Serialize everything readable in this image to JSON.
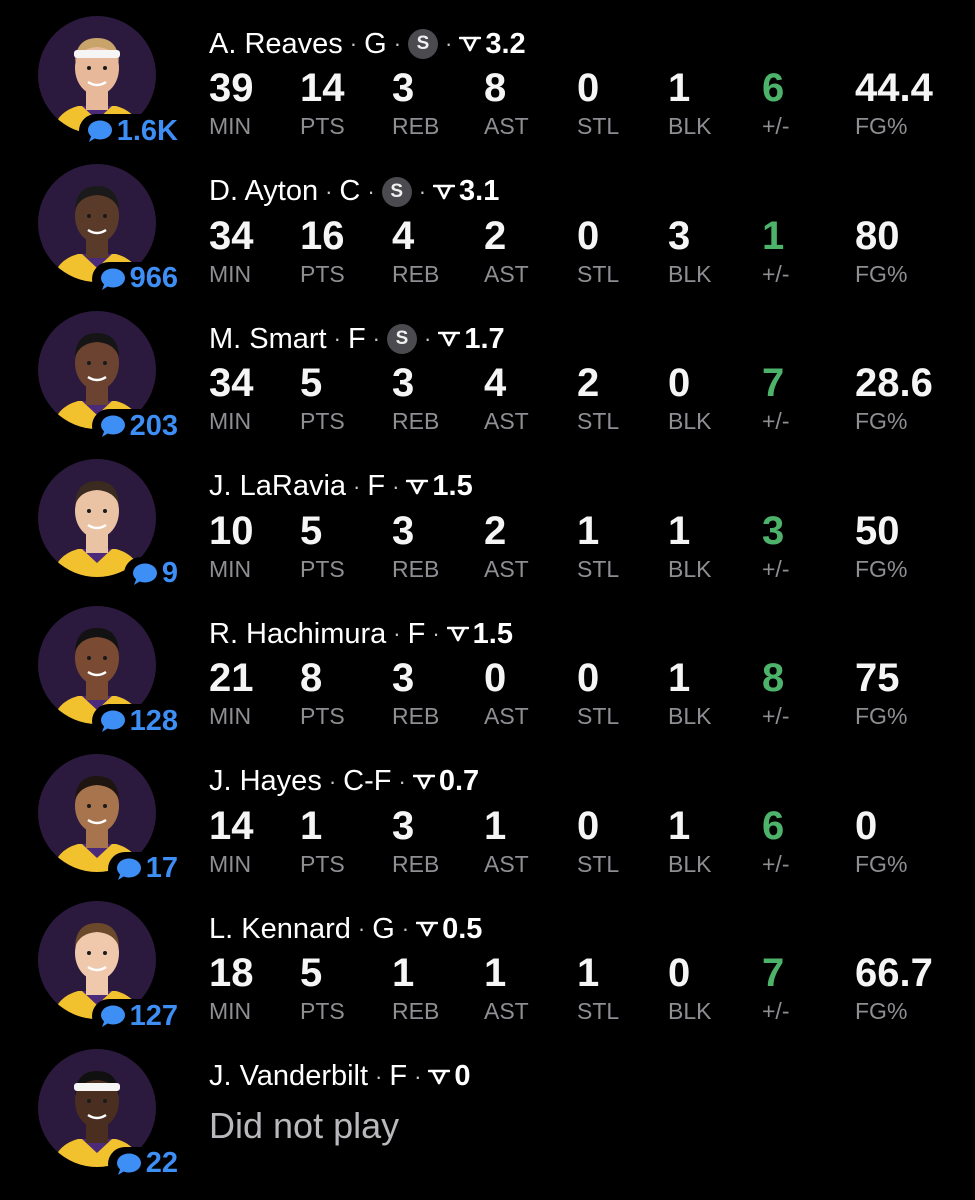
{
  "stat_labels": [
    "MIN",
    "PTS",
    "REB",
    "AST",
    "STL",
    "BLK",
    "+/-",
    "FG%"
  ],
  "colors": {
    "background": "#000000",
    "comment_blue": "#3d8ef5",
    "plus_minus_green": "#4db36b",
    "label_gray": "#8e8e93",
    "avatar_bg": "#2b1a3d",
    "jersey_gold": "#f2c12e"
  },
  "players": [
    {
      "name": "A. Reaves",
      "position": "G",
      "starter": true,
      "starter_icon": "S",
      "rating": "3.2",
      "comments": "1.6K",
      "dnp": false,
      "stats": [
        "39",
        "14",
        "3",
        "8",
        "0",
        "1",
        "6",
        "44.4"
      ],
      "skin": "#e8b89a",
      "hair": "#c8a46a",
      "headband": true
    },
    {
      "name": "D. Ayton",
      "position": "C",
      "starter": true,
      "starter_icon": "S",
      "rating": "3.1",
      "comments": "966",
      "dnp": false,
      "stats": [
        "34",
        "16",
        "4",
        "2",
        "0",
        "3",
        "1",
        "80"
      ],
      "skin": "#5a3a28",
      "hair": "#1a1a1a",
      "headband": false
    },
    {
      "name": "M. Smart",
      "position": "F",
      "starter": true,
      "starter_icon": "S",
      "rating": "1.7",
      "comments": "203",
      "dnp": false,
      "stats": [
        "34",
        "5",
        "3",
        "4",
        "2",
        "0",
        "7",
        "28.6"
      ],
      "skin": "#6b4330",
      "hair": "#151515",
      "headband": false
    },
    {
      "name": "J. LaRavia",
      "position": "F",
      "starter": false,
      "starter_icon": "",
      "rating": "1.5",
      "comments": "9",
      "dnp": false,
      "stats": [
        "10",
        "5",
        "3",
        "2",
        "1",
        "1",
        "3",
        "50"
      ],
      "skin": "#eac2a4",
      "hair": "#3a2a20",
      "headband": false
    },
    {
      "name": "R. Hachimura",
      "position": "F",
      "starter": false,
      "starter_icon": "",
      "rating": "1.5",
      "comments": "128",
      "dnp": false,
      "stats": [
        "21",
        "8",
        "3",
        "0",
        "0",
        "1",
        "8",
        "75"
      ],
      "skin": "#7a4a32",
      "hair": "#121212",
      "headband": false
    },
    {
      "name": "J. Hayes",
      "position": "C-F",
      "starter": false,
      "starter_icon": "",
      "rating": "0.7",
      "comments": "17",
      "dnp": false,
      "stats": [
        "14",
        "1",
        "3",
        "1",
        "0",
        "1",
        "6",
        "0"
      ],
      "skin": "#a8744e",
      "hair": "#1e1510",
      "headband": false
    },
    {
      "name": "L. Kennard",
      "position": "G",
      "starter": false,
      "starter_icon": "",
      "rating": "0.5",
      "comments": "127",
      "dnp": false,
      "stats": [
        "18",
        "5",
        "1",
        "1",
        "1",
        "0",
        "7",
        "66.7"
      ],
      "skin": "#f0c8ac",
      "hair": "#6a4a2a",
      "headband": false
    },
    {
      "name": "J. Vanderbilt",
      "position": "F",
      "starter": false,
      "starter_icon": "",
      "rating": "0",
      "comments": "22",
      "dnp": true,
      "dnp_text": "Did not play",
      "stats": [],
      "skin": "#4a2e20",
      "hair": "#101010",
      "headband": true
    }
  ]
}
